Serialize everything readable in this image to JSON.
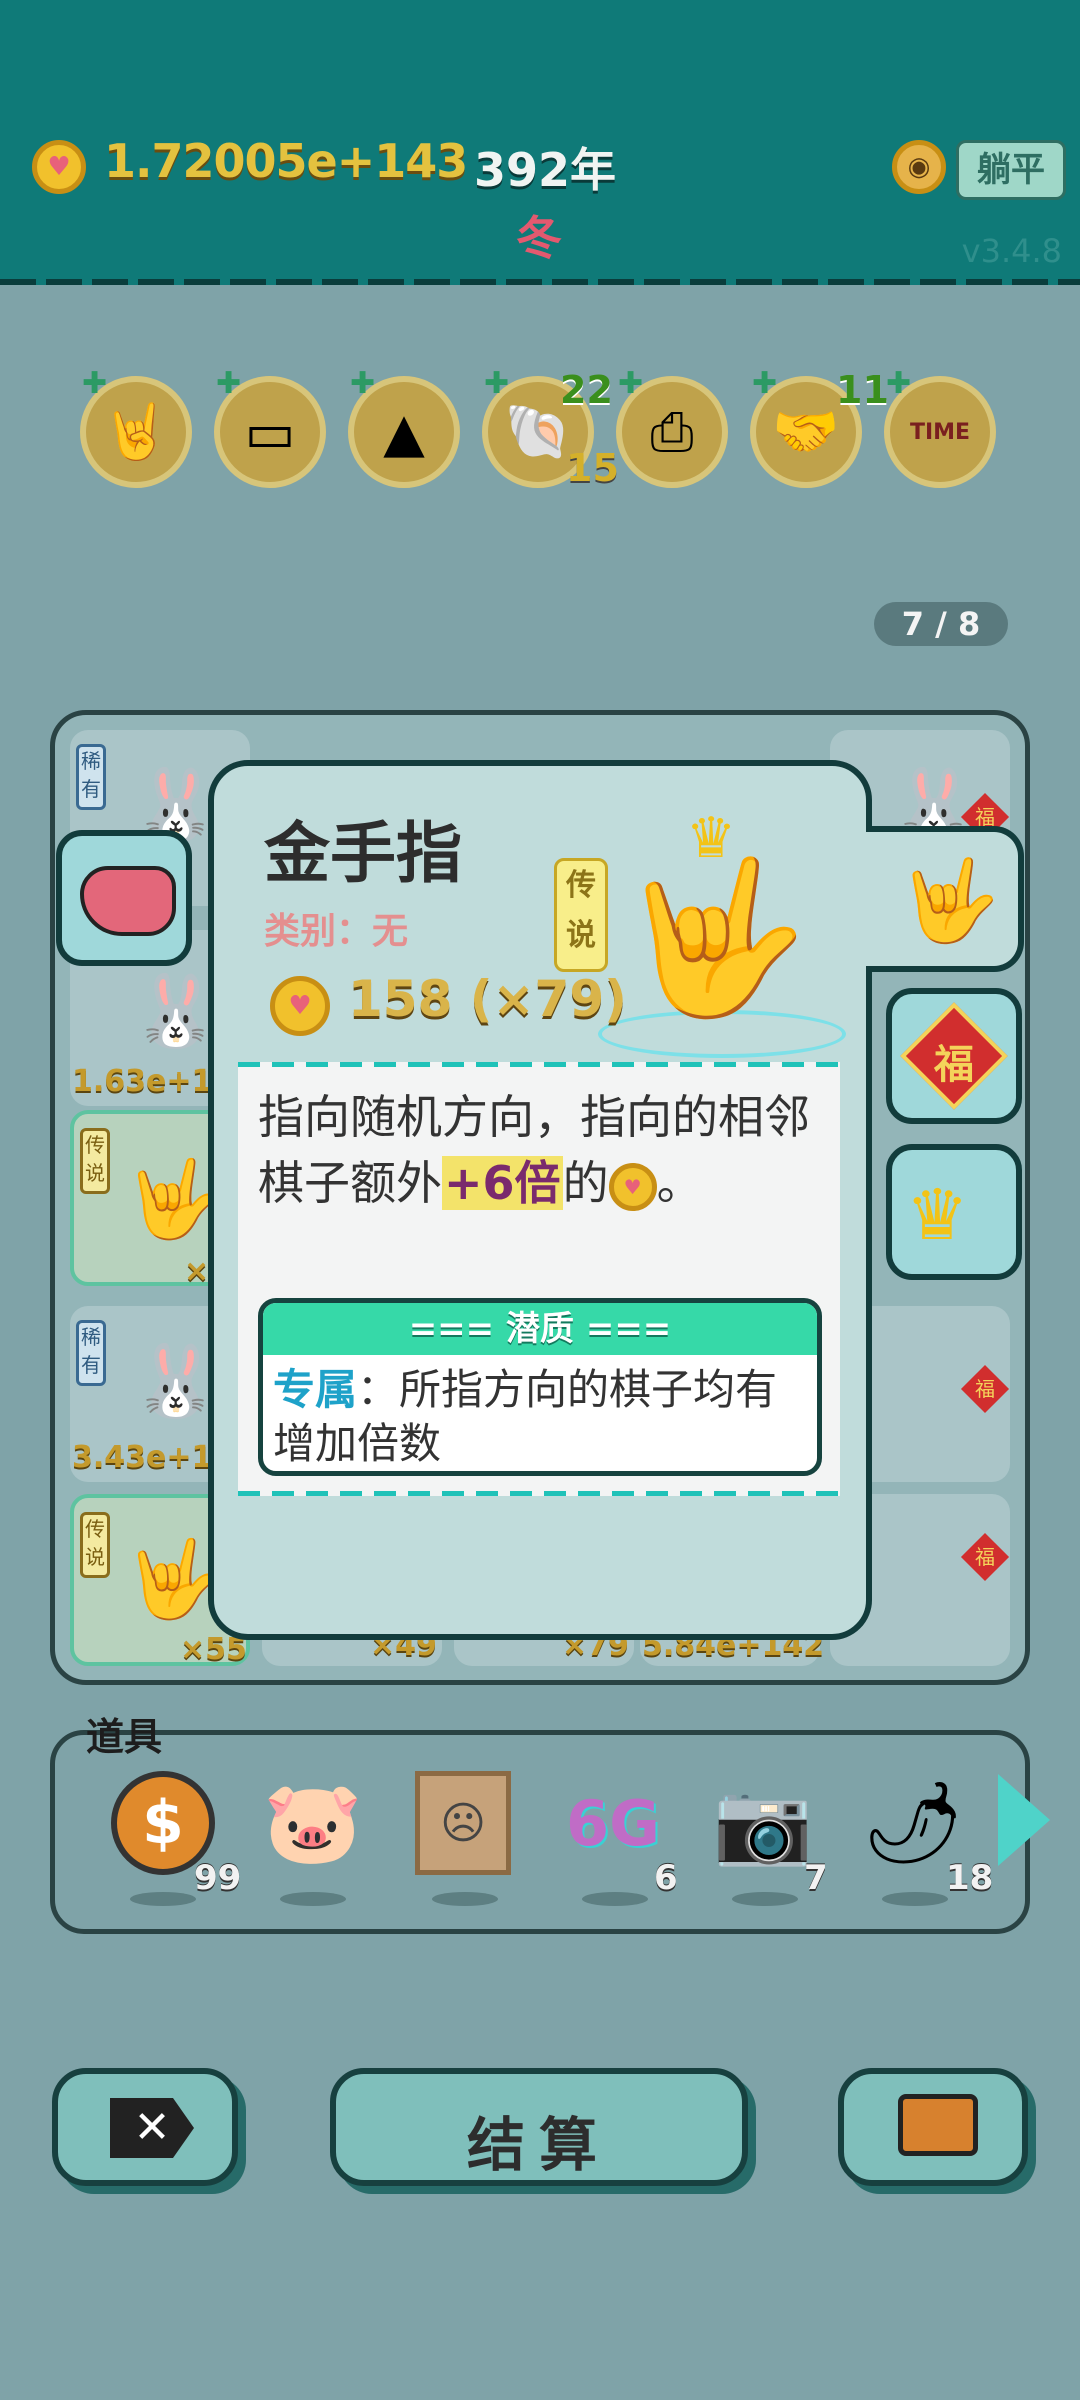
{
  "header": {
    "money": "1.72005e+143",
    "year": "392年",
    "season": "冬",
    "lie_flat_label": "躺平",
    "version": "v3.4.8"
  },
  "item_row": {
    "items": [
      {
        "icon": "rock-hand-icon",
        "count": "",
        "sub": ""
      },
      {
        "icon": "tissue-box-icon",
        "count": "",
        "sub": ""
      },
      {
        "icon": "skirt-icon",
        "count": "",
        "sub": ""
      },
      {
        "icon": "shell-icon",
        "count": "22",
        "sub": "15"
      },
      {
        "icon": "printer-icon",
        "count": "",
        "sub": ""
      },
      {
        "icon": "handshake-icon",
        "count": "11",
        "sub": ""
      },
      {
        "icon": "time-magazine-icon",
        "count": "",
        "sub": ""
      }
    ]
  },
  "page_indicator": "7 / 8",
  "board": {
    "values": [
      "1.63e+1",
      "×",
      "3.43e+1",
      "×55",
      "×49",
      "×79",
      "5.84e+142"
    ],
    "tags": [
      "稀有",
      "传说",
      "稀有",
      "传说"
    ],
    "fu_label": "福"
  },
  "popup": {
    "title": "金手指",
    "category": "类别：无",
    "rarity": "传说",
    "price": "158 (×79)",
    "desc_1": "指向随机方向，指向的相邻棋子额外",
    "desc_bonus": "+6倍",
    "desc_2": "的",
    "desc_3": "。",
    "potential_header": "=== 潜质 ===",
    "potential_key": "专属",
    "potential_text": "：所指方向的棋子均有增加倍数"
  },
  "side_tabs": {
    "fu": "福"
  },
  "props": {
    "label": "道具",
    "items": [
      {
        "icon": "dollar-coin-icon",
        "count": "99"
      },
      {
        "icon": "piggy-bank-icon",
        "count": ""
      },
      {
        "icon": "robot-portrait-icon",
        "count": ""
      },
      {
        "icon": "6g-icon",
        "text": "6G",
        "count": "6"
      },
      {
        "icon": "camera-icon",
        "count": "7"
      },
      {
        "icon": "chili-pepper-icon",
        "count": "18"
      }
    ]
  },
  "buttons": {
    "settle": "结算"
  },
  "colors": {
    "topbar": "#0f7a78",
    "accent": "#36d9a8",
    "coin": "#f1c12c",
    "fu_red": "#d12e2e"
  }
}
